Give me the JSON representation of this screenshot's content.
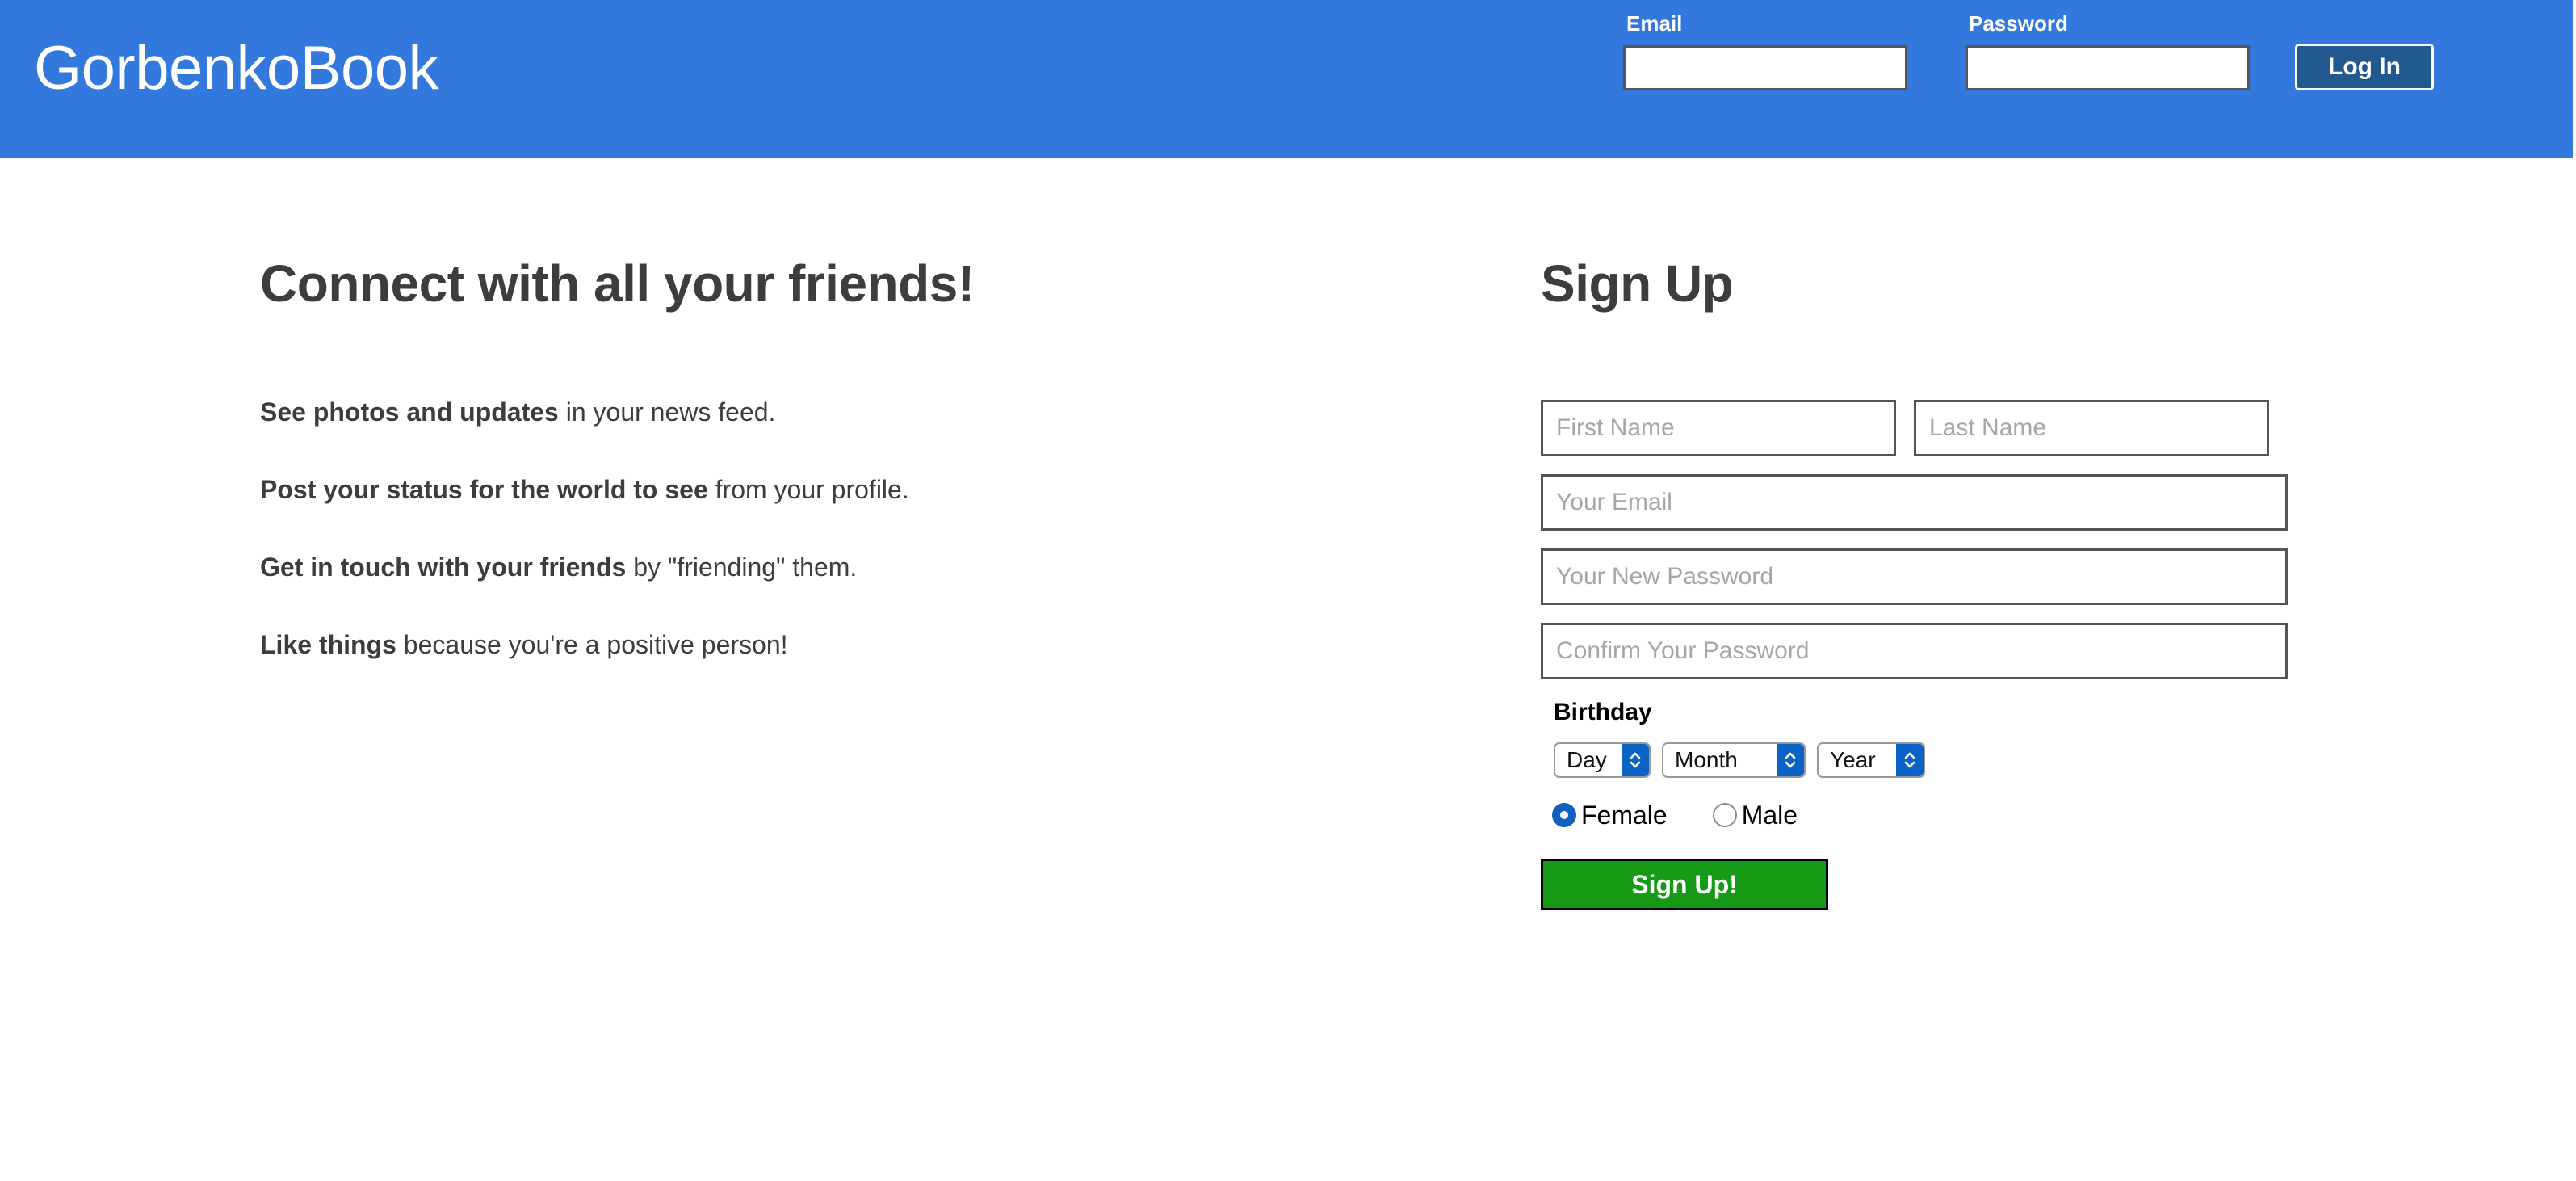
{
  "header": {
    "brand": "GorbenkoBook",
    "background_color": "#3278dd",
    "login": {
      "email_label": "Email",
      "email_value": "",
      "email_placeholder": "",
      "password_label": "Password",
      "password_value": "",
      "password_placeholder": "",
      "login_button": "Log In",
      "login_button_color": "#21598f"
    }
  },
  "pitch": {
    "title": "Connect with all your friends!",
    "items": [
      {
        "bold": "See photos and updates",
        "rest": " in your news feed."
      },
      {
        "bold": "Post your status for the world to see",
        "rest": " from your profile."
      },
      {
        "bold": "Get in touch with your friends",
        "rest": " by \"friending\" them."
      },
      {
        "bold": "Like things",
        "rest": " because you're a positive person!"
      }
    ]
  },
  "signup": {
    "title": "Sign Up",
    "first_name_placeholder": "First Name",
    "first_name_value": "",
    "last_name_placeholder": "Last Name",
    "last_name_value": "",
    "email_placeholder": "Your Email",
    "email_value": "",
    "password_placeholder": "Your New Password",
    "password_value": "",
    "confirm_password_placeholder": "Confirm Your Password",
    "confirm_password_value": "",
    "birthday_label": "Birthday",
    "birthday": {
      "day_selected": "Day",
      "month_selected": "Month",
      "year_selected": "Year"
    },
    "gender": {
      "female_label": "Female",
      "male_label": "Male",
      "selected": "Female"
    },
    "submit_label": "Sign Up!",
    "submit_color": "#169a16"
  }
}
